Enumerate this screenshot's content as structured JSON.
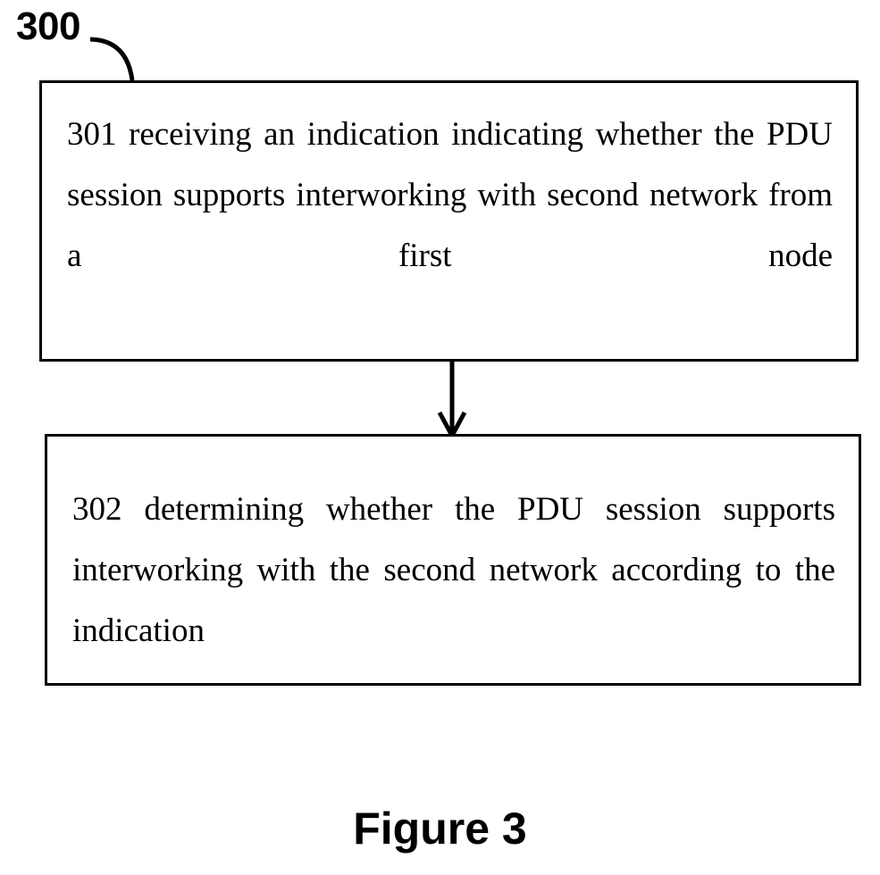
{
  "figure": {
    "reference_numeral": "300",
    "caption": "Figure 3",
    "background_color": "#ffffff",
    "line_color": "#000000"
  },
  "steps": [
    {
      "id": "301",
      "text": "301 receiving an indication indicating whether the PDU session supports interworking with second network from a first node"
    },
    {
      "id": "302",
      "text": "302 determining whether the PDU session supports interworking with the second network according to the indication"
    }
  ],
  "connector": {
    "from": "301",
    "to": "302",
    "direction": "down"
  }
}
